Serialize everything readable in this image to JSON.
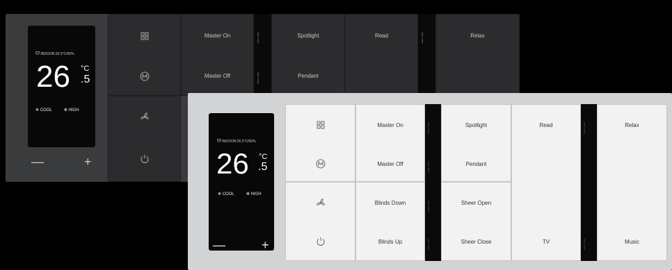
{
  "dark_panel": {
    "status": "INDOOR:26.5°C/50%",
    "temp_int": "26",
    "temp_unit": "°C",
    "temp_dec": ".5",
    "mode_label": "COOL",
    "fan_label": "HIGH",
    "minus": "—",
    "plus": "+",
    "bars": "| |",
    "labels": {
      "master_on": "Master On",
      "master_off": "Master Off",
      "spotlight": "Spotlight",
      "pendant": "Pendant",
      "read": "Read",
      "relax": "Relax"
    }
  },
  "light_panel": {
    "status": "INDOOR:26.5°C/50%",
    "temp_int": "26",
    "temp_unit": "°C",
    "temp_dec": ".5",
    "mode_label": "COOL",
    "fan_label": "HIGH",
    "minus": "—",
    "plus": "+",
    "bars": "| |",
    "labels": {
      "master_on": "Master On",
      "master_off": "Master Off",
      "blinds_down": "Blinds Down",
      "blinds_up": "Blinds Up",
      "spotlight": "Spotlight",
      "pendant": "Pendant",
      "sheer_open": "Sheer Open",
      "sheer_close": "Sheer Close",
      "read": "Read",
      "tv": "TV",
      "relax": "Relax",
      "music": "Music"
    }
  },
  "icons": [
    "grid-icon",
    "m-circle-icon",
    "fan-icon",
    "power-icon",
    "snowflake-icon",
    "ac-unit-icon"
  ]
}
